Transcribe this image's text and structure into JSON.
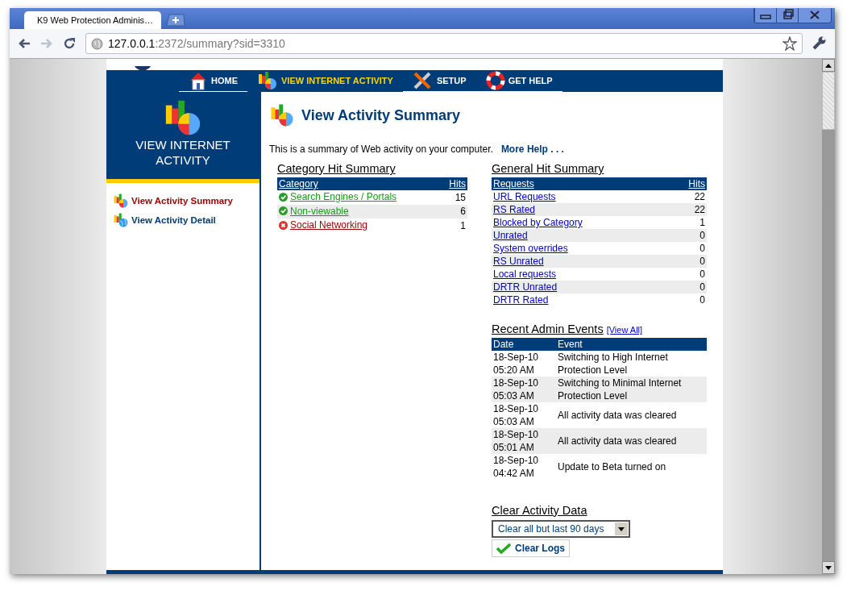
{
  "browser": {
    "tab_title": "K9 Web Protection Adminis…",
    "url_host": "127.0.0.1",
    "url_path": ":2372/summary?sid=3310"
  },
  "nav": [
    {
      "label": "HOME",
      "selected": false
    },
    {
      "label": "VIEW INTERNET ACTIVITY",
      "selected": true
    },
    {
      "label": "SETUP",
      "selected": false
    },
    {
      "label": "GET HELP",
      "selected": false
    }
  ],
  "sidebar": {
    "title": "VIEW INTERNET ACTIVITY",
    "items": [
      {
        "label": "View Activity Summary",
        "selected": true
      },
      {
        "label": "View Activity Detail",
        "selected": false
      }
    ]
  },
  "page": {
    "title": "View Activity Summary",
    "intro": "This is a summary of Web activity on your computer.",
    "more_help": "More Help . . ."
  },
  "category_hit_summary": {
    "title": "Category Hit Summary",
    "columns": [
      "Category",
      "Hits"
    ],
    "rows": [
      {
        "category": "Search Engines / Portals",
        "hits": "15",
        "kind": "allowed"
      },
      {
        "category": "Non-viewable",
        "hits": "6",
        "kind": "allowed"
      },
      {
        "category": "Social Networking",
        "hits": "1",
        "kind": "blocked"
      }
    ]
  },
  "general_hit_summary": {
    "title": "General Hit Summary",
    "columns": [
      "Requests",
      "Hits"
    ],
    "rows": [
      {
        "request": "URL Requests",
        "hits": "22"
      },
      {
        "request": "RS Rated",
        "hits": "22"
      },
      {
        "request": "Blocked by Category",
        "hits": "1"
      },
      {
        "request": "Unrated",
        "hits": "0"
      },
      {
        "request": "System overrides",
        "hits": "0"
      },
      {
        "request": "RS Unrated",
        "hits": "0"
      },
      {
        "request": "Local requests",
        "hits": "0"
      },
      {
        "request": "DRTR Unrated",
        "hits": "0"
      },
      {
        "request": "DRTR Rated",
        "hits": "0"
      }
    ]
  },
  "recent_admin_events": {
    "title": "Recent Admin Events",
    "view_all": "[View All]",
    "columns": [
      "Date",
      "Event"
    ],
    "rows": [
      {
        "date": "18-Sep-10",
        "time": "05:20 AM",
        "event": "Switching to High Internet Protection Level"
      },
      {
        "date": "18-Sep-10",
        "time": "05:03 AM",
        "event": "Switching to Minimal Internet Protection Level"
      },
      {
        "date": "18-Sep-10",
        "time": "05:03 AM",
        "event": "All activity data was cleared"
      },
      {
        "date": "18-Sep-10",
        "time": "05:01 AM",
        "event": "All activity data was cleared"
      },
      {
        "date": "18-Sep-10",
        "time": "04:42 AM",
        "event": "Update to Beta turned on"
      }
    ]
  },
  "clear_activity_data": {
    "title": "Clear Activity Data",
    "select_value": "Clear all but last 90 days",
    "button": "Clear Logs"
  }
}
